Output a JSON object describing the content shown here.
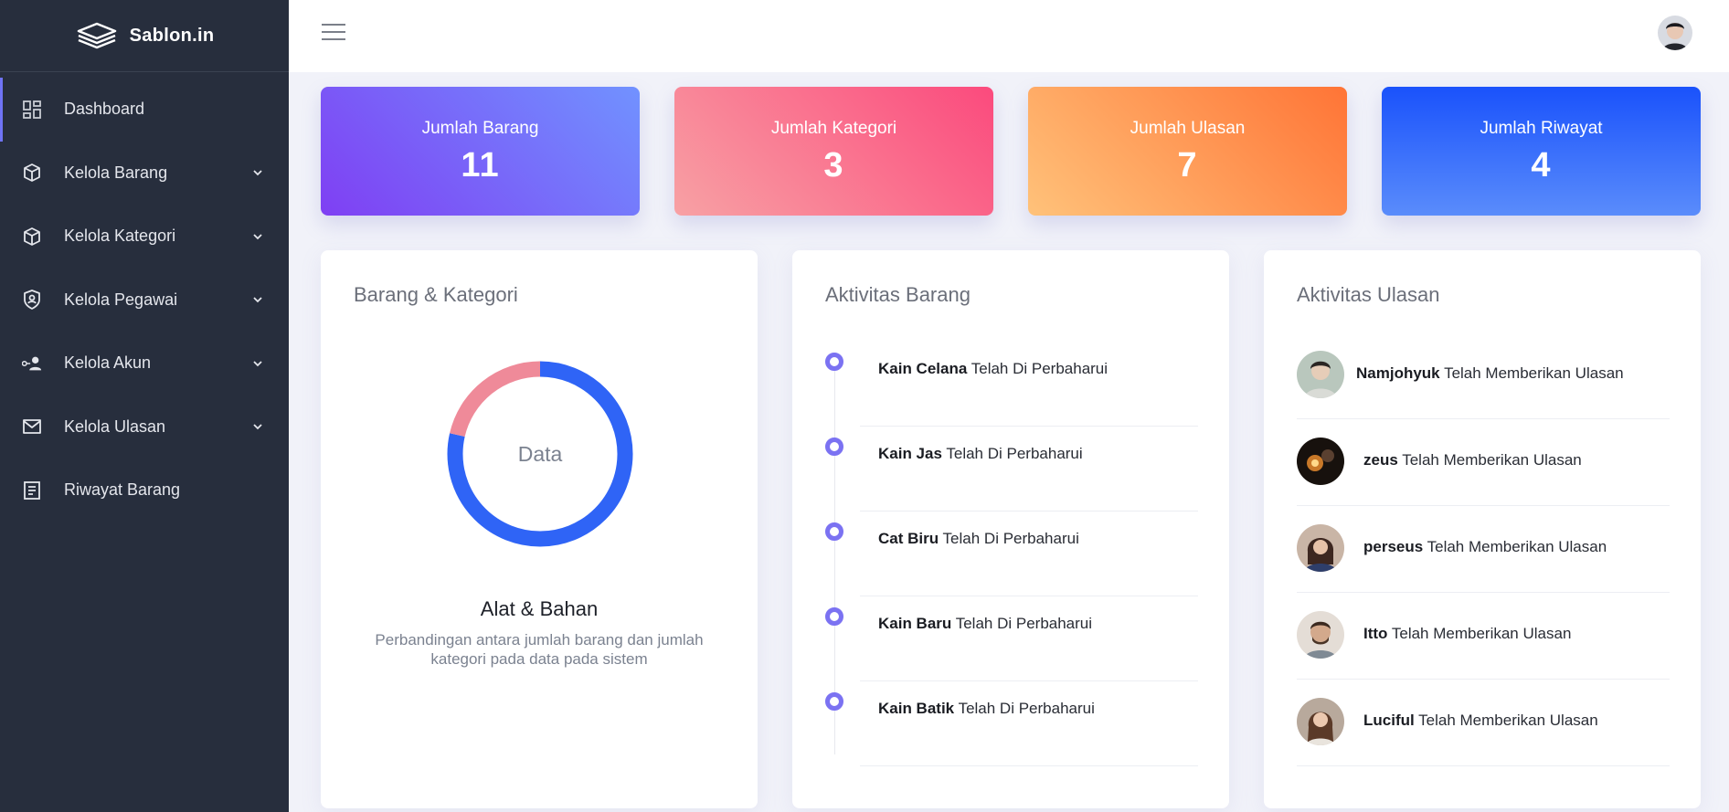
{
  "brand": {
    "name": "Sablon.in",
    "logo_icon": "layers-icon"
  },
  "topbar": {
    "menu_icon": "hamburger-icon",
    "avatar": "user-avatar"
  },
  "sidebar": {
    "items": [
      {
        "label": "Dashboard",
        "icon": "dashboard-icon",
        "active": true
      },
      {
        "label": "Kelola Barang",
        "icon": "box-icon",
        "dropdown": true
      },
      {
        "label": "Kelola Kategori",
        "icon": "box-icon",
        "dropdown": true
      },
      {
        "label": "Kelola Pegawai",
        "icon": "shield-user-icon",
        "dropdown": true
      },
      {
        "label": "Kelola Akun",
        "icon": "user-key-icon",
        "dropdown": true
      },
      {
        "label": "Kelola Ulasan",
        "icon": "mail-icon",
        "dropdown": true
      },
      {
        "label": "Riwayat Barang",
        "icon": "document-icon"
      }
    ]
  },
  "stats": [
    {
      "label": "Jumlah Barang",
      "value": "11"
    },
    {
      "label": "Jumlah Kategori",
      "value": "3"
    },
    {
      "label": "Jumlah Ulasan",
      "value": "7"
    },
    {
      "label": "Jumlah Riwayat",
      "value": "4"
    }
  ],
  "barang_kategori": {
    "title": "Barang & Kategori",
    "center_label": "Data",
    "subtitle": "Alat & Bahan",
    "description": "Perbandingan antara jumlah barang dan jumlah kategori pada data pada sistem",
    "segments": [
      {
        "name": "Barang",
        "value": 11,
        "color": "#2f64f6"
      },
      {
        "name": "Kategori",
        "value": 3,
        "color": "#ef8a99"
      }
    ]
  },
  "aktivitas_barang": {
    "title": "Aktivitas Barang",
    "items": [
      {
        "name": "Kain Celana",
        "text": "Telah Di Perbaharui"
      },
      {
        "name": "Kain Jas",
        "text": "Telah Di Perbaharui"
      },
      {
        "name": "Cat Biru",
        "text": "Telah Di Perbaharui"
      },
      {
        "name": "Kain Baru",
        "text": "Telah Di Perbaharui"
      },
      {
        "name": "Kain Batik",
        "text": "Telah Di Perbaharui"
      }
    ]
  },
  "aktivitas_ulasan": {
    "title": "Aktivitas Ulasan",
    "items": [
      {
        "name": "Namjohyuk",
        "text": "Telah Memberikan Ulasan",
        "avatar_color": "#9fb3a8"
      },
      {
        "name": "zeus",
        "text": "Telah Memberikan Ulasan",
        "avatar_color": "#2b1a12"
      },
      {
        "name": "perseus",
        "text": "Telah Memberikan Ulasan",
        "avatar_color": "#6e4a3c"
      },
      {
        "name": "Itto",
        "text": "Telah Memberikan Ulasan",
        "avatar_color": "#a88f80"
      },
      {
        "name": "Luciful",
        "text": "Telah Memberikan Ulasan",
        "avatar_color": "#7a5a48"
      }
    ]
  }
}
